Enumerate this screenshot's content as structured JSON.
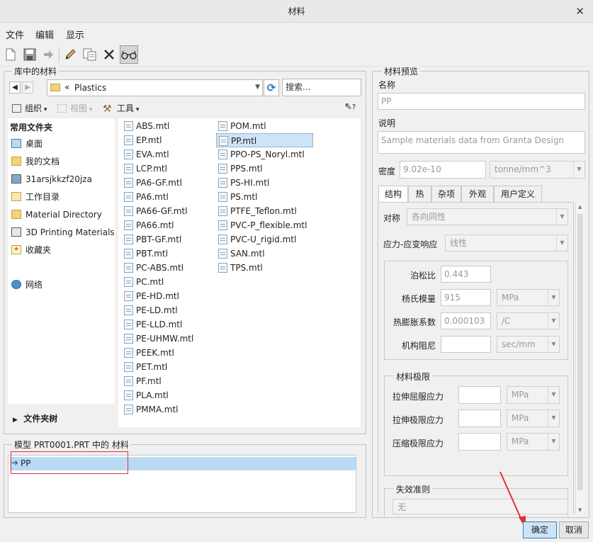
{
  "window": {
    "title": "材料"
  },
  "menu": [
    "文件",
    "编辑",
    "显示"
  ],
  "library": {
    "group_label": "库中的材料",
    "path": "Plastics",
    "path_prefix": "«",
    "search_placeholder": "搜索...",
    "organize_label": "组织",
    "view_label": "视图",
    "tools_label": "工具",
    "help_glyph": "?",
    "nav_header": "常用文件夹",
    "nav_items": [
      {
        "label": "桌面",
        "icon": "desktop-icon"
      },
      {
        "label": "我的文档",
        "icon": "documents-icon"
      },
      {
        "label": "31arsjkkzf20jza",
        "icon": "computer-icon"
      },
      {
        "label": "工作目录",
        "icon": "working-dir-icon"
      },
      {
        "label": "Material Directory",
        "icon": "folder-icon"
      },
      {
        "label": "3D Printing Materials",
        "icon": "folder-3d-icon"
      },
      {
        "label": "收藏夹",
        "icon": "favorites-icon"
      },
      {
        "label": "网络",
        "icon": "network-icon"
      }
    ],
    "folder_tree_label": "文件夹树",
    "files_col1": [
      "ABS.mtl",
      "EP.mtl",
      "EVA.mtl",
      "LCP.mtl",
      "PA6-GF.mtl",
      "PA6.mtl",
      "PA66-GF.mtl",
      "PA66.mtl",
      "PBT-GF.mtl",
      "PBT.mtl",
      "PC-ABS.mtl",
      "PC.mtl",
      "PE-HD.mtl",
      "PE-LD.mtl",
      "PE-LLD.mtl",
      "PE-UHMW.mtl",
      "PEEK.mtl",
      "PET.mtl",
      "PF.mtl",
      "PLA.mtl",
      "PMMA.mtl"
    ],
    "files_col2": [
      "POM.mtl",
      "PP.mtl",
      "PPO-PS_Noryl.mtl",
      "PPS.mtl",
      "PS-HI.mtl",
      "PS.mtl",
      "PTFE_Teflon.mtl",
      "PVC-P_flexible.mtl",
      "PVC-U_rigid.mtl",
      "SAN.mtl",
      "TPS.mtl"
    ],
    "selected_file": "PP.mtl"
  },
  "model": {
    "group_label": "模型 PRT0001.PRT 中的 材料",
    "items": [
      "PP"
    ]
  },
  "preview": {
    "group_label": "材料预览",
    "name_label": "名称",
    "name_value": "PP",
    "desc_label": "说明",
    "desc_value": "Sample materials data from Granta Design",
    "density_label": "密度",
    "density_value": "9.02e-10",
    "density_unit": "tonne/mm^3",
    "tabs": [
      "结构",
      "热",
      "杂项",
      "外观",
      "用户定义"
    ],
    "symmetry_label": "对称",
    "symmetry_value": "各向同性",
    "stress_label": "应力-应变响应",
    "stress_value": "线性",
    "poisson_label": "泊松比",
    "poisson_value": "0.443",
    "young_label": "杨氏模量",
    "young_value": "915",
    "young_unit": "MPa",
    "thermal_label": "热膨胀系数",
    "thermal_value": "0.000103",
    "thermal_unit": "/C",
    "damping_label": "机构阻尼",
    "damping_value": "",
    "damping_unit": "sec/mm",
    "limits_label": "材料极限",
    "tensile_yield_label": "拉伸屈服应力",
    "tensile_yield_unit": "MPa",
    "tensile_ult_label": "拉伸极限应力",
    "tensile_ult_unit": "MPa",
    "compress_label": "压缩极限应力",
    "compress_unit": "MPa",
    "failure_label": "失效准则",
    "failure_value": "无"
  },
  "buttons": {
    "ok": "确定",
    "cancel": "取消"
  },
  "colors": {
    "selection": "#b9daf4",
    "accent": "#3c7fb1",
    "annotation_red": "#e03030"
  }
}
